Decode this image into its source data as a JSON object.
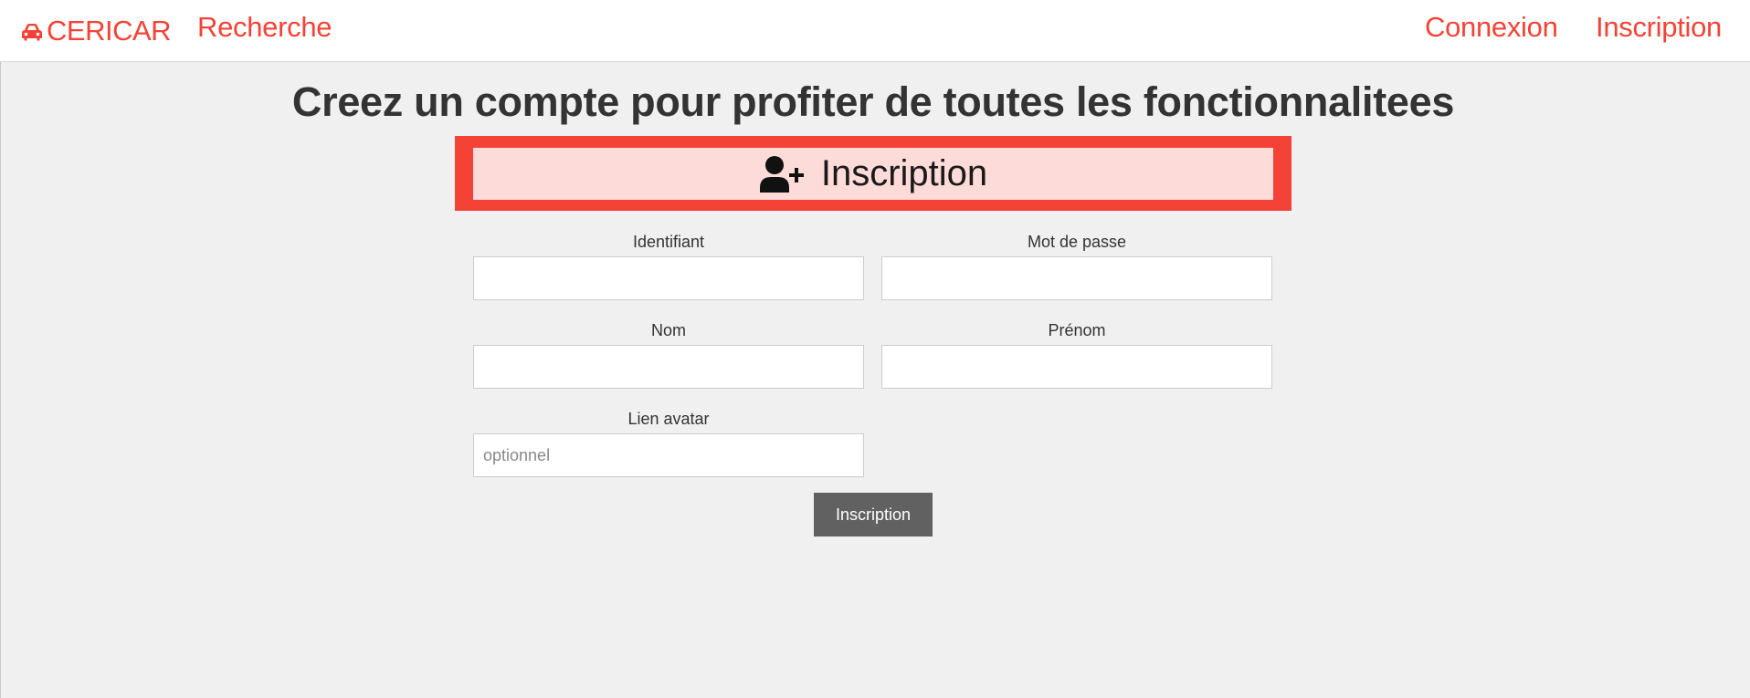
{
  "nav": {
    "brand": "CERICAR",
    "brand_icon": "car-icon",
    "search": "Recherche",
    "login": "Connexion",
    "signup": "Inscription"
  },
  "main": {
    "heading": "Creez un compte pour profiter de toutes les fonctionnalitees",
    "banner": {
      "icon": "user-plus-icon",
      "title": "Inscription"
    },
    "form": {
      "username": {
        "label": "Identifiant",
        "value": "",
        "placeholder": ""
      },
      "password": {
        "label": "Mot de passe",
        "value": "",
        "placeholder": ""
      },
      "lastname": {
        "label": "Nom",
        "value": "",
        "placeholder": ""
      },
      "firstname": {
        "label": "Prénom",
        "value": "",
        "placeholder": ""
      },
      "avatar": {
        "label": "Lien avatar",
        "value": "",
        "placeholder": "optionnel"
      },
      "submit": "Inscription"
    }
  },
  "colors": {
    "accent": "#f44336",
    "banner_bg": "#fddbd8",
    "button_bg": "#616161",
    "page_bg": "#f0f0f0"
  }
}
